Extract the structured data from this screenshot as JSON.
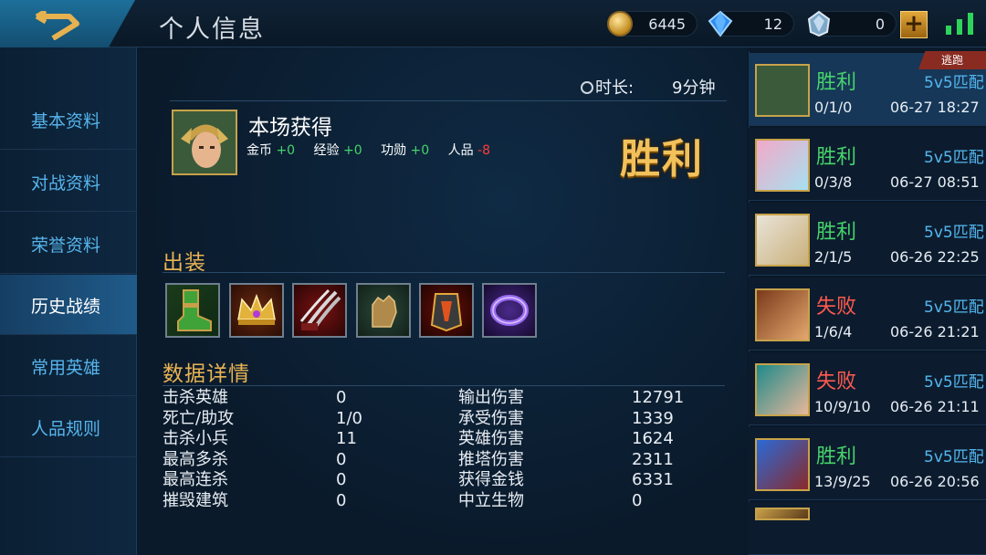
{
  "header": {
    "title": "个人信息",
    "gold": "6445",
    "diamonds": "12",
    "vouchers": "0",
    "plus": "+"
  },
  "sidebar": {
    "items": [
      {
        "label": "基本资料"
      },
      {
        "label": "对战资料"
      },
      {
        "label": "荣誉资料"
      },
      {
        "label": "历史战绩"
      },
      {
        "label": "常用英雄"
      },
      {
        "label": "人品规则"
      }
    ],
    "active_index": 3
  },
  "detail": {
    "duration_label": "时长:",
    "duration_value": "9分钟",
    "earnings_title": "本场获得",
    "gold_label": "金币",
    "gold_value": "+0",
    "exp_label": "经验",
    "exp_value": "+0",
    "merit_label": "功勋",
    "merit_value": "+0",
    "rep_label": "人品",
    "rep_value": "-8",
    "result": "胜利",
    "equip_title": "出装",
    "equip_icons": [
      "boots-icon",
      "crown-icon",
      "claw-blade-icon",
      "gauntlet-icon",
      "fire-armor-icon",
      "purple-ring-icon"
    ],
    "stats_title": "数据详情",
    "stats_left": [
      {
        "label": "击杀英雄",
        "value": "0"
      },
      {
        "label": "死亡/助攻",
        "value": "1/0"
      },
      {
        "label": "击杀小兵",
        "value": "11"
      },
      {
        "label": "最高多杀",
        "value": "0"
      },
      {
        "label": "最高连杀",
        "value": "0"
      },
      {
        "label": "摧毁建筑",
        "value": "0"
      }
    ],
    "stats_right": [
      {
        "label": "输出伤害",
        "value": "12791"
      },
      {
        "label": "承受伤害",
        "value": "1339"
      },
      {
        "label": "英雄伤害",
        "value": "1624"
      },
      {
        "label": "推塔伤害",
        "value": "2311"
      },
      {
        "label": "获得金钱",
        "value": "6331"
      },
      {
        "label": "中立生物",
        "value": "0"
      }
    ]
  },
  "matches": {
    "flee_tag": "逃跑",
    "items": [
      {
        "result": "胜利",
        "mode": "5v5匹配",
        "kda": "0/1/0",
        "date": "06-27 18:27"
      },
      {
        "result": "胜利",
        "mode": "5v5匹配",
        "kda": "0/3/8",
        "date": "06-27 08:51"
      },
      {
        "result": "胜利",
        "mode": "5v5匹配",
        "kda": "2/1/5",
        "date": "06-26 22:25"
      },
      {
        "result": "失败",
        "mode": "5v5匹配",
        "kda": "1/6/4",
        "date": "06-26 21:21"
      },
      {
        "result": "失败",
        "mode": "5v5匹配",
        "kda": "10/9/10",
        "date": "06-26 21:11"
      },
      {
        "result": "胜利",
        "mode": "5v5匹配",
        "kda": "13/9/25",
        "date": "06-26 20:56"
      }
    ]
  }
}
